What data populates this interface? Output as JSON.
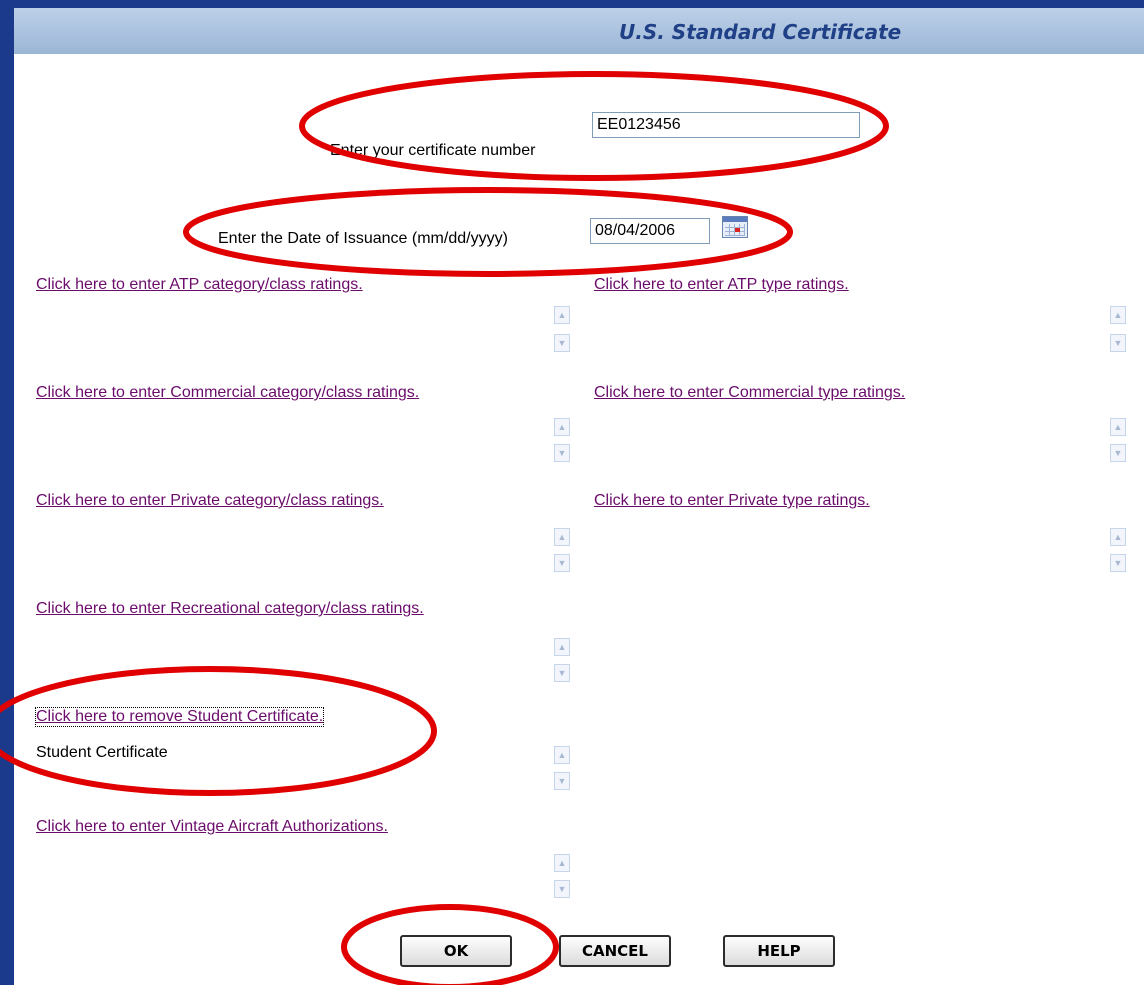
{
  "header": {
    "title": "U.S. Standard Certificate"
  },
  "certificate": {
    "label": "Enter your certificate number",
    "value": "EE0123456"
  },
  "issuance": {
    "label": "Enter the Date of Issuance (mm/dd/yyyy)",
    "value": "08/04/2006",
    "calendar_icon": "calendar-icon"
  },
  "links": {
    "atp_category": "Click here to enter ATP category/class ratings.",
    "atp_type": "Click here to enter ATP type ratings.",
    "commercial_category": "Click here to enter Commercial category/class ratings.",
    "commercial_type": "Click here to enter Commercial type ratings.",
    "private_category": "Click here to enter Private category/class ratings.",
    "private_type": "Click here to enter Private type ratings.",
    "recreational_category": "Click here to enter Recreational category/class ratings.",
    "remove_student": "Click here to remove Student Certificate.",
    "vintage": "Click here to enter Vintage Aircraft Authorizations."
  },
  "student_list": {
    "item": "Student Certificate"
  },
  "buttons": {
    "ok": "OK",
    "cancel": "CANCEL",
    "help": "HELP"
  },
  "colors": {
    "page_background": "#1c3a8c",
    "title_bar": "#a9c1e0",
    "title_text": "#1f3f86",
    "link": "#6b0c6b",
    "annotation_ellipse": "#e00000"
  }
}
